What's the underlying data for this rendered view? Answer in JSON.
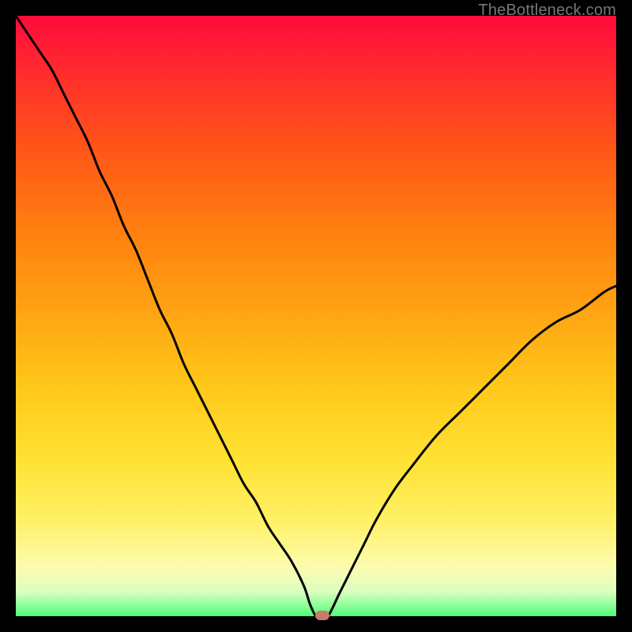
{
  "watermark": "TheBottleneck.com",
  "colors": {
    "frame": "#000000",
    "curve": "#000000",
    "marker": "#c97a6b"
  },
  "chart_data": {
    "type": "line",
    "title": "",
    "xlabel": "",
    "ylabel": "",
    "xlim": [
      0,
      100
    ],
    "ylim": [
      0,
      100
    ],
    "grid": false,
    "legend": false,
    "series": [
      {
        "name": "bottleneck-curve",
        "x": [
          0,
          2,
          4,
          6,
          8,
          10,
          12,
          14,
          16,
          18,
          20,
          22,
          24,
          26,
          28,
          30,
          32,
          34,
          36,
          38,
          40,
          42,
          44,
          46,
          48,
          49,
          50,
          51,
          52,
          54,
          56,
          58,
          60,
          63,
          66,
          70,
          74,
          78,
          82,
          86,
          90,
          94,
          98,
          100
        ],
        "y": [
          100,
          97,
          94,
          91,
          87,
          83,
          79,
          74,
          70,
          65,
          61,
          56,
          51,
          47,
          42,
          38,
          34,
          30,
          26,
          22,
          19,
          15,
          12,
          9,
          5,
          2,
          0,
          0,
          0,
          4,
          8,
          12,
          16,
          21,
          25,
          30,
          34,
          38,
          42,
          46,
          49,
          51,
          54,
          55
        ]
      }
    ],
    "marker": {
      "x": 51,
      "y": 0
    }
  }
}
